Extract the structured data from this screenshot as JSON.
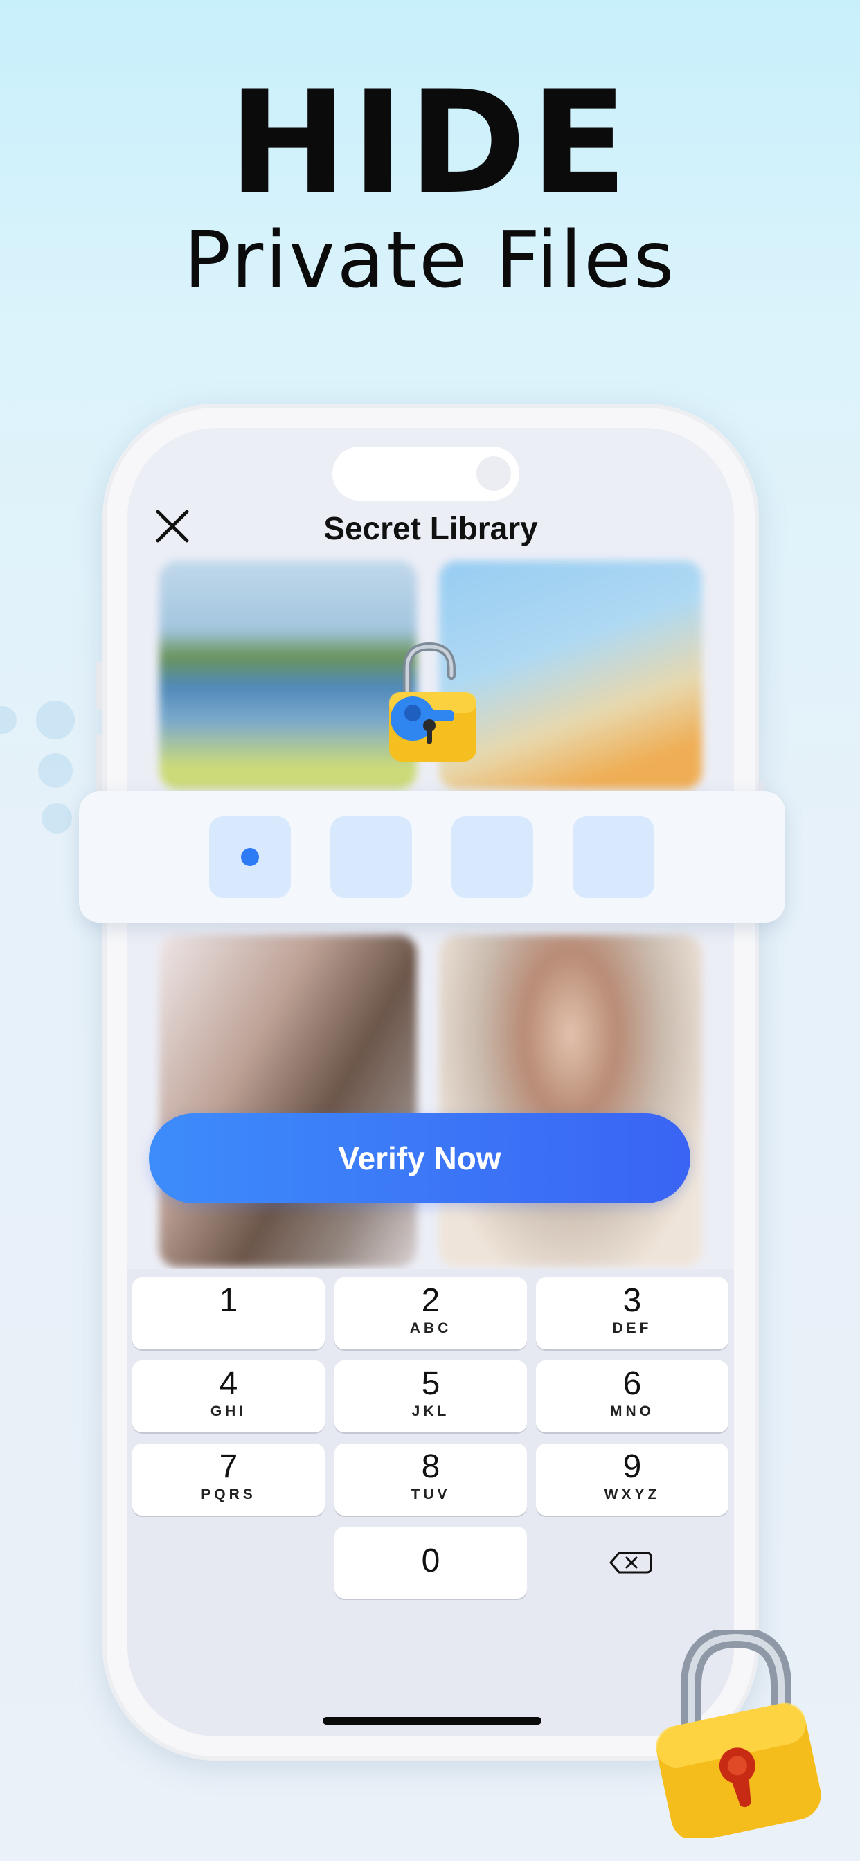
{
  "hero": {
    "title": "HIDE",
    "subtitle": "Private Files"
  },
  "screen": {
    "title": "Secret Library",
    "close_icon": "close-icon",
    "verify_button": "Verify Now",
    "pin": {
      "length": 4,
      "filled": 1
    }
  },
  "keypad": {
    "keys": [
      {
        "num": "1",
        "letters": ""
      },
      {
        "num": "2",
        "letters": "ABC"
      },
      {
        "num": "3",
        "letters": "DEF"
      },
      {
        "num": "4",
        "letters": "GHI"
      },
      {
        "num": "5",
        "letters": "JKL"
      },
      {
        "num": "6",
        "letters": "MNO"
      },
      {
        "num": "7",
        "letters": "PQRS"
      },
      {
        "num": "8",
        "letters": "TUV"
      },
      {
        "num": "9",
        "letters": "WXYZ"
      },
      {
        "num": "0",
        "letters": ""
      }
    ],
    "backspace_icon": "backspace-icon"
  },
  "colors": {
    "accent": "#3a74f6",
    "pin_box": "#d9e9fd",
    "lock_body": "#f7c326"
  }
}
